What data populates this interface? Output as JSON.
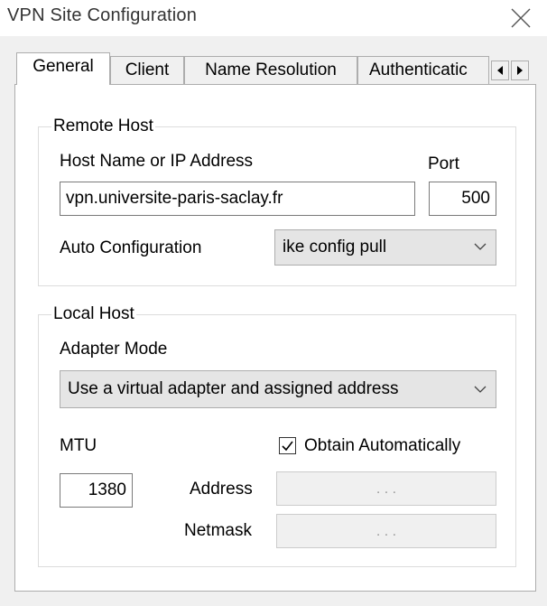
{
  "window": {
    "title": "VPN Site Configuration",
    "close_icon": "close-icon"
  },
  "tabs": [
    {
      "label": "General",
      "active": true
    },
    {
      "label": "Client",
      "active": false
    },
    {
      "label": "Name Resolution",
      "active": false
    },
    {
      "label": "Authenticatic",
      "active": false
    }
  ],
  "tab_scroll": {
    "left_icon": "triangle-left-icon",
    "right_icon": "triangle-right-icon"
  },
  "remote_host": {
    "legend": "Remote Host",
    "host_label": "Host Name or IP Address",
    "host_value": "vpn.universite-paris-saclay.fr",
    "port_label": "Port",
    "port_value": "500",
    "auto_config_label": "Auto Configuration",
    "auto_config_value": "ike config pull"
  },
  "local_host": {
    "legend": "Local Host",
    "adapter_mode_label": "Adapter Mode",
    "adapter_mode_value": "Use a virtual adapter and assigned address",
    "mtu_label": "MTU",
    "mtu_value": "1380",
    "obtain_auto_label": "Obtain Automatically",
    "obtain_auto_checked": true,
    "address_label": "Address",
    "address_value": ".  .  .",
    "netmask_label": "Netmask",
    "netmask_value": ".  .  ."
  },
  "colors": {
    "dialog_bg": "#f0f0f0",
    "page_bg": "#ffffff",
    "border": "#adadad",
    "combo_bg": "#e5e5e5"
  }
}
